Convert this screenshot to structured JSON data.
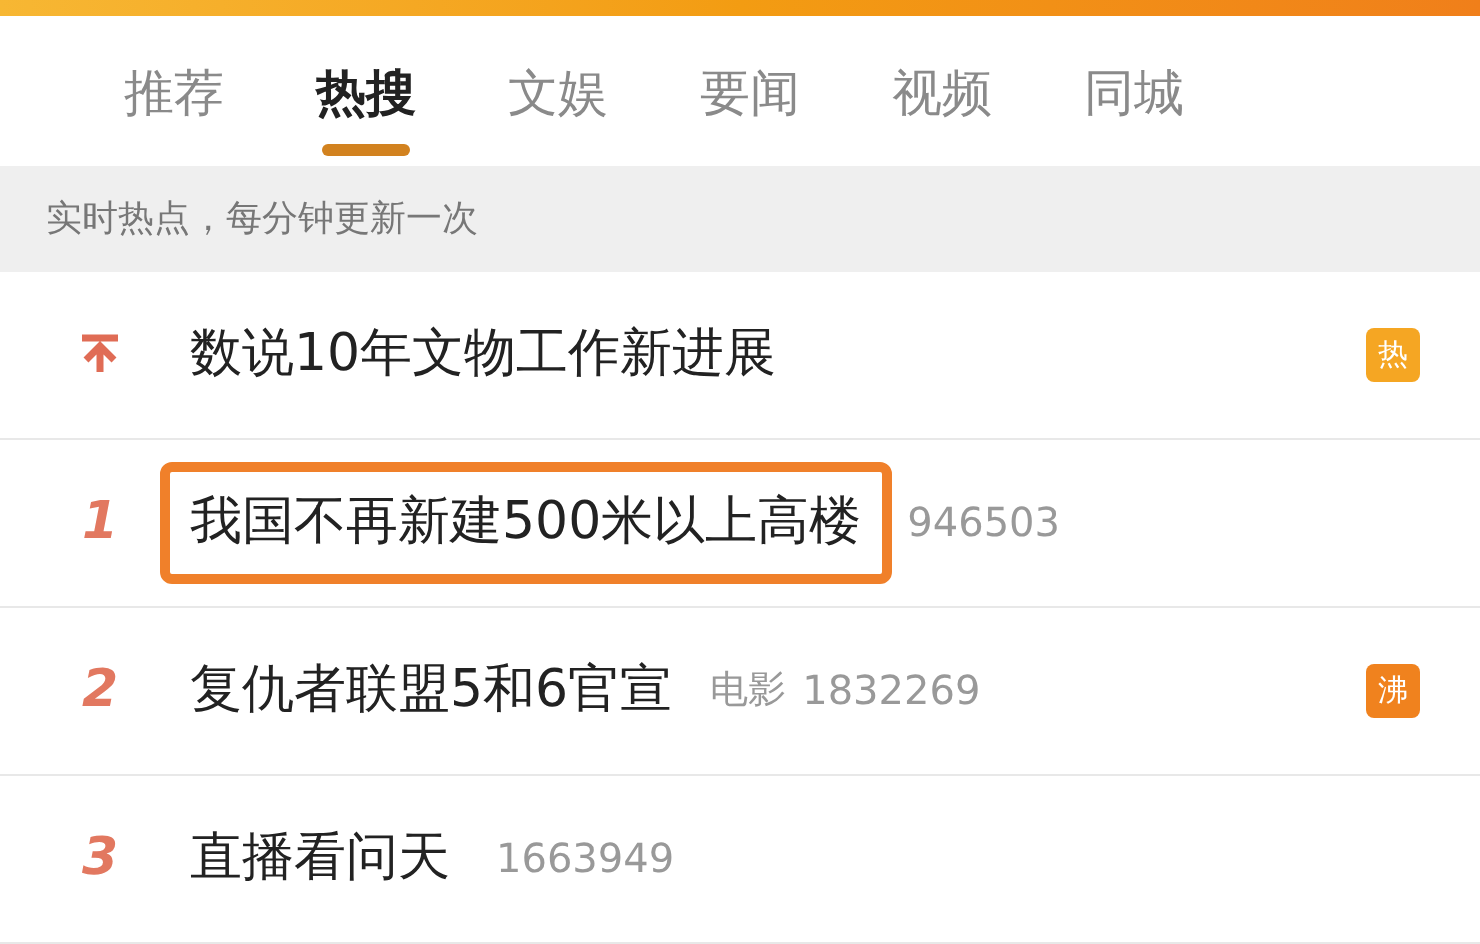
{
  "tabs": [
    {
      "label": "推荐",
      "selected": false
    },
    {
      "label": "热搜",
      "selected": true
    },
    {
      "label": "文娱",
      "selected": false
    },
    {
      "label": "要闻",
      "selected": false
    },
    {
      "label": "视频",
      "selected": false
    },
    {
      "label": "同城",
      "selected": false
    }
  ],
  "notice": "实时热点，每分钟更新一次",
  "items": [
    {
      "kind": "pinned",
      "title": "数说10年文物工作新进展",
      "badge": {
        "label": "热",
        "color": "#f5a623"
      },
      "highlighted": false
    },
    {
      "kind": "ranked",
      "rank": "1",
      "title": "我国不再新建500米以上高楼",
      "count": "946503",
      "highlighted": true
    },
    {
      "kind": "ranked",
      "rank": "2",
      "title": "复仇者联盟5和6官宣",
      "category": "电影",
      "count": "1832269",
      "badge": {
        "label": "沸",
        "color": "#f0821e"
      },
      "highlighted": false
    },
    {
      "kind": "ranked",
      "rank": "3",
      "title": "直播看问天",
      "count": "1663949",
      "highlighted": false
    }
  ]
}
